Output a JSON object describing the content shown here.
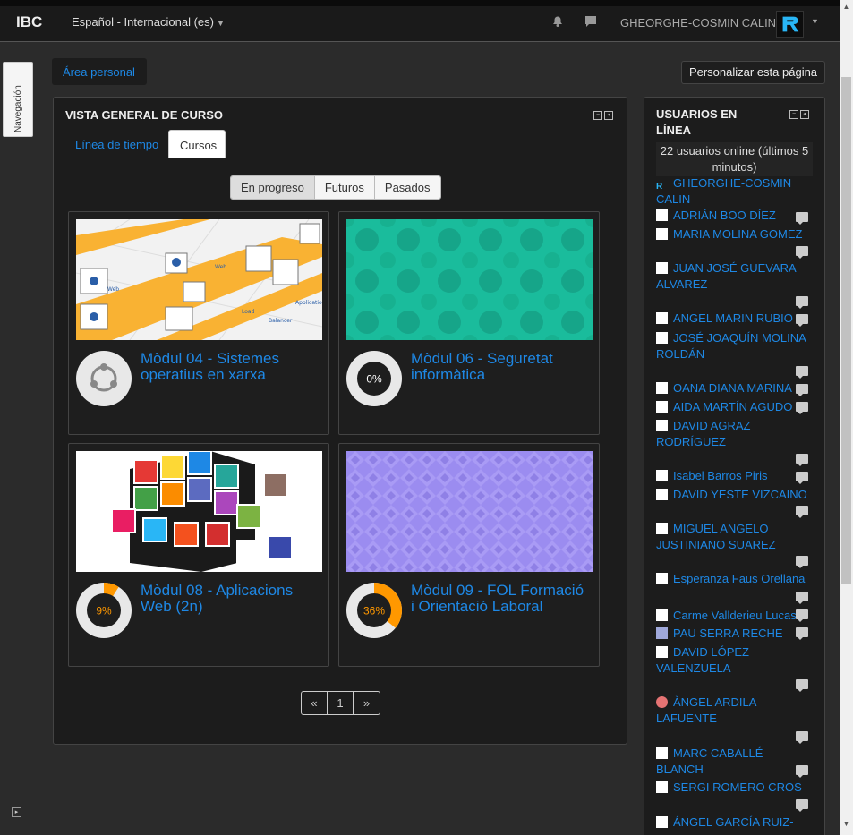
{
  "app": {
    "brand": "IBC",
    "language": "Español - Internacional (es)",
    "user_name": "GHEORGHE-COSMIN CALIN"
  },
  "nav_drawer": {
    "label": "Navegación"
  },
  "breadcrumb": {
    "home": "Área personal"
  },
  "customize_button": "Personalizar esta página",
  "course_overview": {
    "title": "VISTA GENERAL DE CURSO",
    "tabs": [
      "Línea de tiempo",
      "Cursos"
    ],
    "filters": [
      "En progreso",
      "Futuros",
      "Pasados"
    ],
    "courses": [
      {
        "name": "Mòdul 04 - Sistemes operatius en xarxa",
        "progress_label": ""
      },
      {
        "name": "Mòdul 06 - Seguretat informàtica",
        "progress_label": "0%",
        "progress": 0
      },
      {
        "name": "Mòdul 08 - Aplicacions Web (2n)",
        "progress_label": "9%",
        "progress": 9
      },
      {
        "name": "Mòdul 09 - FOL Formació i Orientació Laboral",
        "progress_label": "36%",
        "progress": 36
      }
    ],
    "pager": {
      "prev": "«",
      "page": "1",
      "next": "»"
    }
  },
  "online_users": {
    "title": "USUARIOS EN LÍNEA",
    "count_text": "22 usuarios online (últimos 5 minutos)",
    "users": [
      "GHEORGHE-COSMIN CALIN",
      "ADRIÁN BOO DÍEZ",
      "MARIA MOLINA GOMEZ",
      "JUAN JOSÉ GUEVARA ALVAREZ",
      "ANGEL MARIN RUBIO",
      "JOSÉ JOAQUÍN MOLINA ROLDÁN",
      "OANA DIANA MARINA",
      "AIDA MARTÍN AGUDO",
      "DAVID AGRAZ RODRÍGUEZ",
      "Isabel Barros Piris",
      "DAVID YESTE VIZCAINO",
      "MIGUEL ANGELO JUSTINIANO SUAREZ",
      "Esperanza Faus Orellana",
      "Carme Vallderieu Lucas",
      "PAU SERRA RECHE",
      "DAVID LÓPEZ VALENZUELA",
      "ÀNGEL ARDILA LAFUENTE",
      "MARC CABALLÉ BLANCH",
      "SERGI ROMERO CROS",
      "ÁNGEL GARCÍA RUIZ-"
    ]
  },
  "colors": {
    "accent": "#1e88e5",
    "progress": "#ff9800",
    "card_teal": "#1abc9c",
    "card_purple": "#9b8cf0"
  }
}
